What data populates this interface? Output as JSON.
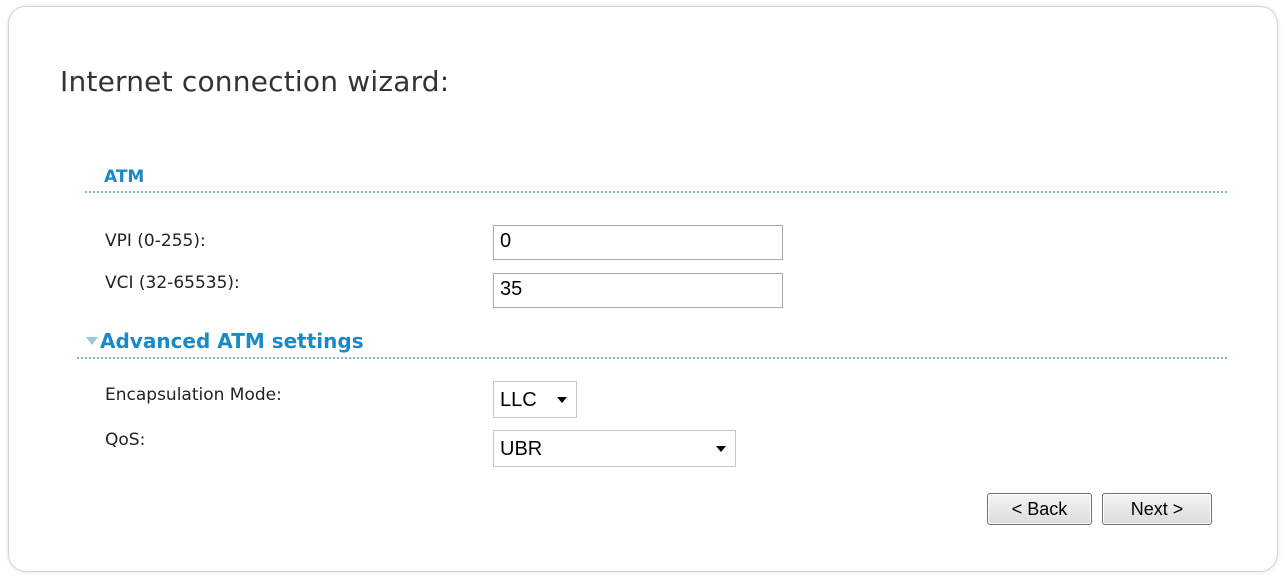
{
  "wizard": {
    "title": "Internet connection wizard:"
  },
  "atm": {
    "heading": "ATM",
    "vpi": {
      "label": "VPI (0-255):",
      "value": "0"
    },
    "vci": {
      "label": "VCI (32-65535):",
      "value": "35"
    }
  },
  "advanced": {
    "heading": "Advanced ATM settings",
    "encapsulation": {
      "label": "Encapsulation Mode:",
      "selected": "LLC"
    },
    "qos": {
      "label": "QoS:",
      "selected": "UBR"
    }
  },
  "buttons": {
    "back": "< Back",
    "next": "Next >"
  },
  "colors": {
    "section_heading": "#1a8ac7",
    "dotted_rule": "#79b9dc"
  }
}
